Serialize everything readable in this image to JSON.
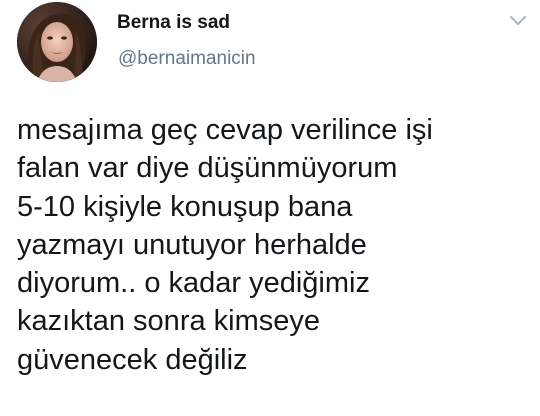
{
  "user": {
    "display_name": "Berna is sad",
    "handle": "@bernaimanicin",
    "avatar_icon": "profile-photo"
  },
  "menu": {
    "icon": "chevron-down-icon"
  },
  "tweet": {
    "lines": [
      "mesajıma geç cevap verilince işi",
      "falan var diye düşünmüyorum",
      "5-10 kişiyle konuşup bana",
      "yazmayı unutuyor herhalde",
      "diyorum.. o kadar yediğimiz",
      "kazıktan sonra kimseye",
      "güvenecek değiliz"
    ]
  },
  "colors": {
    "text": "#14171a",
    "secondary": "#657786",
    "chevron": "#aab8c2",
    "background": "#ffffff"
  }
}
